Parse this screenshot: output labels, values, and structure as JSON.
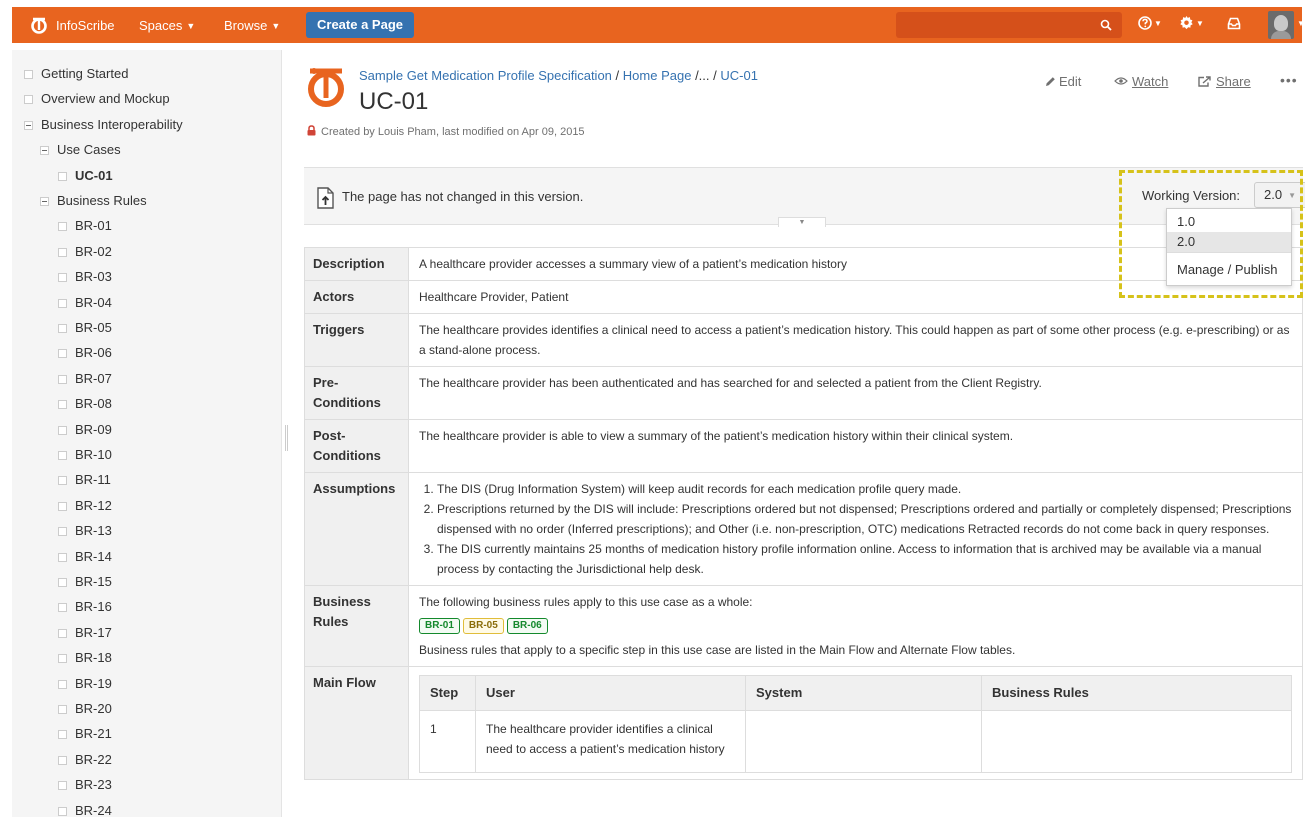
{
  "topbar": {
    "brand": "InfoScribe",
    "nav": [
      {
        "label": "Spaces",
        "caret": "▼"
      },
      {
        "label": "Browse",
        "caret": "▼"
      }
    ],
    "create_label": "Create a Page",
    "icons": [
      "help-icon",
      "settings-icon",
      "notifications-icon"
    ],
    "colors": {
      "bar": "#e8641f",
      "create": "#3572b0"
    }
  },
  "sidebar": {
    "items": [
      {
        "label": "Getting Started"
      },
      {
        "label": "Overview and Mockup"
      },
      {
        "label": "Business Interoperability"
      },
      {
        "label": "Use Cases"
      },
      {
        "label": "UC-01"
      },
      {
        "label": "Business Rules"
      },
      {
        "label": "BR-01"
      },
      {
        "label": "BR-02"
      },
      {
        "label": "BR-03"
      },
      {
        "label": "BR-04"
      },
      {
        "label": "BR-05"
      },
      {
        "label": "BR-06"
      },
      {
        "label": "BR-07"
      },
      {
        "label": "BR-08"
      },
      {
        "label": "BR-09"
      },
      {
        "label": "BR-10"
      },
      {
        "label": "BR-11"
      },
      {
        "label": "BR-12"
      },
      {
        "label": "BR-13"
      },
      {
        "label": "BR-14"
      },
      {
        "label": "BR-15"
      },
      {
        "label": "BR-16"
      },
      {
        "label": "BR-17"
      },
      {
        "label": "BR-18"
      },
      {
        "label": "BR-19"
      },
      {
        "label": "BR-20"
      },
      {
        "label": "BR-21"
      },
      {
        "label": "BR-22"
      },
      {
        "label": "BR-23"
      },
      {
        "label": "BR-24"
      }
    ]
  },
  "page": {
    "breadcrumb": {
      "part1": "Sample Get Medication Profile Specification",
      "sep": "/",
      "part2": "Home Page",
      "sep2": "/...",
      "sep3": "/",
      "part3": "UC-01"
    },
    "title": "UC-01",
    "byline": "Created by Louis Pham, last modified on Apr 09, 2015",
    "actions": {
      "edit": "Edit",
      "watch": "Watch",
      "share": "Share",
      "more": "•••"
    }
  },
  "version_bar": {
    "message": "The page has not changed in this version.",
    "toggle": "▼",
    "working_label": "Working Version:",
    "selected": "2.0",
    "caret": "▼",
    "options": [
      "1.0",
      "2.0"
    ],
    "manage": "Manage / Publish"
  },
  "table": {
    "description_h": "Description",
    "description": "A healthcare provider accesses a summary view of a patient’s medication history",
    "actors_h": "Actors",
    "actors": "Healthcare Provider, Patient",
    "triggers_h": "Triggers",
    "triggers": "The healthcare provides identifies a clinical need to access a patient’s medication history. This could happen as part of some other process (e.g. e-prescribing) or as a stand-alone process.",
    "pre_h": "Pre-Conditions",
    "pre": "The healthcare provider has been authenticated and has searched for and selected a patient from the Client Registry.",
    "post_h": "Post-Conditions",
    "post": "The healthcare provider is able to view a summary of the patient’s medication history within their clinical system.",
    "assumptions_h": "Assumptions",
    "assumptions": [
      "The DIS (Drug Information System) will keep audit records for each medication profile query made.",
      "Prescriptions returned by the DIS will include: Prescriptions ordered but not dispensed; Prescriptions ordered and partially or completely dispensed; Prescriptions dispensed with no order (Inferred prescriptions); and Other (i.e. non-prescription, OTC) medications Retracted records do not come back in query responses.",
      "The DIS currently maintains 25 months of medication history profile information online. Access to information that is archived may be available via a manual process by contacting the Jurisdictional help desk."
    ],
    "rules_h": "Business Rules",
    "rules_intro": "The following business rules apply to this use case as a whole:",
    "rules_badges": [
      "BR-01",
      "BR-05",
      "BR-06"
    ],
    "rules_outro": "Business rules that apply to a specific step in this use case are listed in the Main Flow and Alternate Flow tables.",
    "main_flow_h": "Main Flow",
    "flow_headers": [
      "Step",
      "User",
      "System",
      "Business Rules"
    ],
    "flow_rows": [
      {
        "step": "1",
        "user": "The healthcare provider identifies a clinical need to access a patient’s medication history",
        "system": "",
        "rules": ""
      }
    ]
  }
}
